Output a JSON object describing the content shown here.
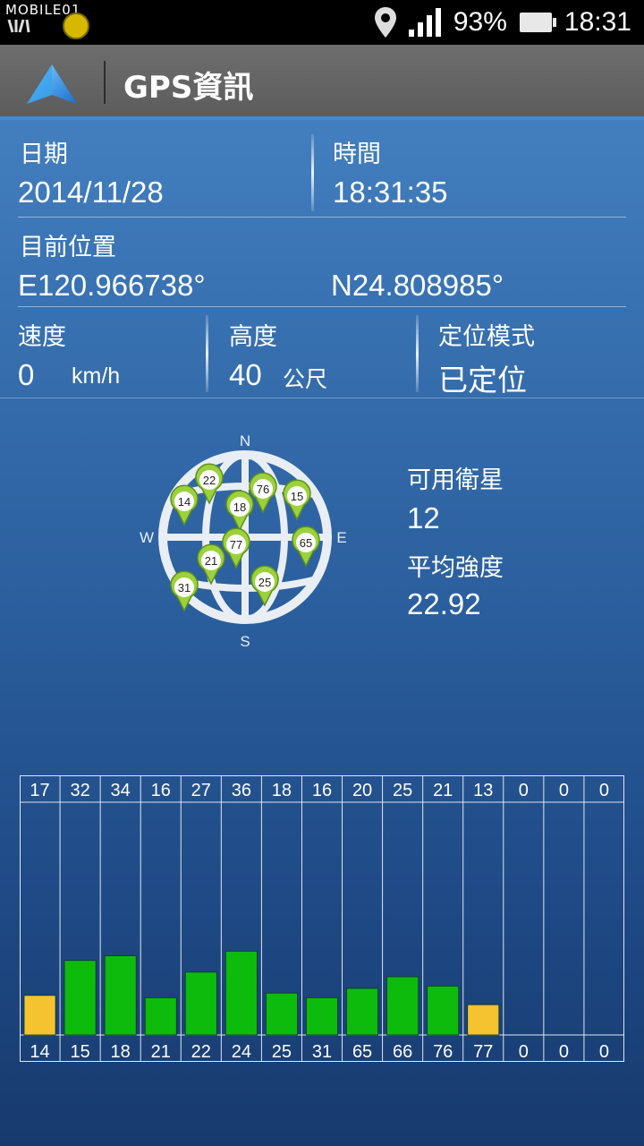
{
  "status_bar": {
    "logo": "MOBILE01",
    "battery": "93%",
    "time": "18:31",
    "icons": [
      "location-pin-icon",
      "signal-icon",
      "battery-icon"
    ]
  },
  "action_bar": {
    "title": "GPS資訊",
    "icon": "navigation-arrow-icon"
  },
  "info": {
    "date_label": "日期",
    "date_value": "2014/11/28",
    "time_label": "時間",
    "time_value": "18:31:35",
    "position_label": "目前位置",
    "longitude": "E120.966738°",
    "latitude": "N24.808985°",
    "speed_label": "速度",
    "speed_value": "0",
    "speed_unit": "km/h",
    "altitude_label": "高度",
    "altitude_value": "40",
    "altitude_unit": "公尺",
    "mode_label": "定位模式",
    "mode_value": "已定位"
  },
  "sky": {
    "compass": {
      "n": "N",
      "s": "S",
      "e": "E",
      "w": "W"
    },
    "pins": [
      "22",
      "14",
      "18",
      "76",
      "15",
      "77",
      "65",
      "21",
      "31",
      "25"
    ],
    "available_label": "可用衛星",
    "available_value": "12",
    "avg_label": "平均強度",
    "avg_value": "22.92"
  },
  "chart_data": {
    "type": "bar",
    "categories": [
      "14",
      "15",
      "18",
      "21",
      "22",
      "24",
      "25",
      "31",
      "65",
      "66",
      "76",
      "77",
      "0",
      "0",
      "0"
    ],
    "values": [
      17,
      32,
      34,
      16,
      27,
      36,
      18,
      16,
      20,
      25,
      21,
      13,
      0,
      0,
      0
    ],
    "top_labels": [
      "17",
      "32",
      "34",
      "16",
      "27",
      "36",
      "18",
      "16",
      "20",
      "25",
      "21",
      "13",
      "0",
      "0",
      "0"
    ],
    "bar_colors": [
      "#f5c230",
      "#0dbb0d",
      "#0dbb0d",
      "#0dbb0d",
      "#0dbb0d",
      "#0dbb0d",
      "#0dbb0d",
      "#0dbb0d",
      "#0dbb0d",
      "#0dbb0d",
      "#0dbb0d",
      "#f5c230",
      "#0dbb0d",
      "#0dbb0d",
      "#0dbb0d"
    ],
    "ylim": [
      0,
      100
    ],
    "grid": true
  },
  "colors": {
    "accent": "#3c8bd6",
    "bar_green": "#0dbb0d",
    "bar_yellow": "#f5c230",
    "pin_green": "#9bd23c"
  }
}
